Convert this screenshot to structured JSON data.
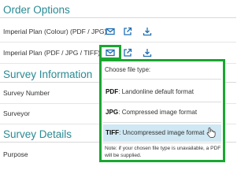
{
  "sections": {
    "order_options": "Order Options",
    "survey_information": "Survey Information",
    "survey_details": "Survey Details"
  },
  "order_rows": [
    {
      "label": "Imperial Plan (Colour) (PDF / JPG)"
    },
    {
      "label": "Imperial Plan (PDF / JPG / TIFF)"
    }
  ],
  "icons": {
    "email": "mail-icon",
    "open": "external-link-icon",
    "download": "download-icon",
    "cursor": "pointer-hand-icon"
  },
  "survey_rows": {
    "survey_number": "Survey Number",
    "surveyor": "Surveyor",
    "purpose": "Purpose"
  },
  "popup": {
    "title": "Choose file type:",
    "options": [
      {
        "format": "PDF",
        "description": ": Landonline default format"
      },
      {
        "format": "JPG",
        "description": ": Compressed image format"
      },
      {
        "format": "TIFF",
        "description": ": Uncompressed image format"
      }
    ],
    "highlighted_option": "TIFF",
    "note": "Note: if your chosen file type is unavailable, a PDF will be supplied."
  },
  "colors": {
    "heading": "#2a8a93",
    "icon": "#1f6fb5",
    "highlight_border": "#1aa632",
    "hover": "#cfe8f3"
  }
}
